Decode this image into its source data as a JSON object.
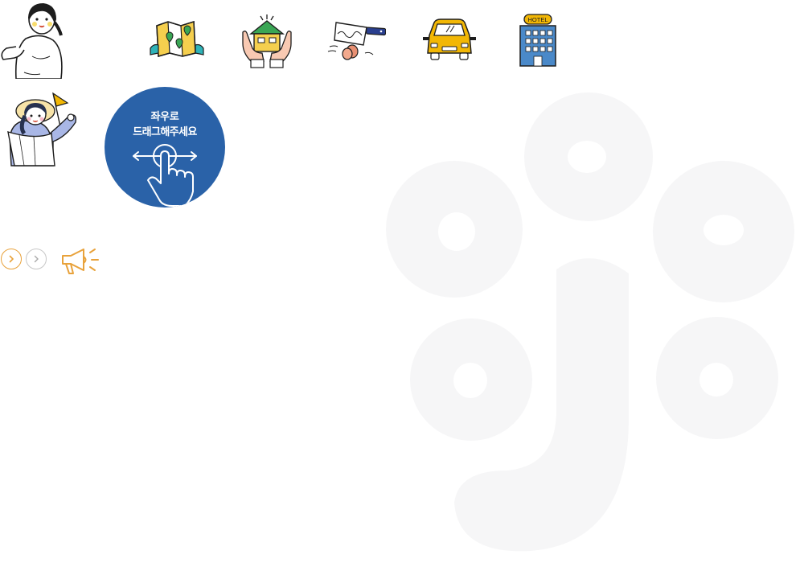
{
  "drag_hint": {
    "line1": "좌우로",
    "line2": "드래그해주세요"
  },
  "hotel_sign": "HOTEL",
  "icons": [
    "map-icon",
    "house-in-hands-icon",
    "knife-icon",
    "taxi-icon",
    "hotel-icon",
    "megaphone-icon",
    "chevron-right-icon"
  ],
  "colors": {
    "hint_blue": "#2a62a8",
    "accent_orange": "#e8a23b",
    "taxi_yellow": "#f2b705",
    "hotel_blue": "#4a89c9",
    "house_green": "#3aa655",
    "watermark": "#f6f6f7"
  }
}
